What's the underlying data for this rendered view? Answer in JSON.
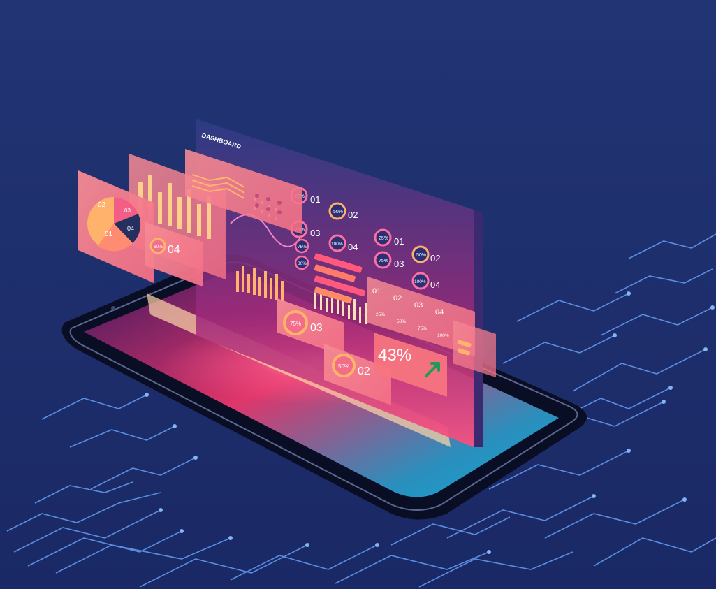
{
  "dashboard": {
    "title": "DASHBOARD"
  },
  "cards": {
    "pie": {
      "labels": [
        "02",
        "03",
        "04",
        "01"
      ]
    },
    "left_stat": {
      "percent": "60%",
      "number": "04"
    },
    "main_list": {
      "rows": [
        {
          "percent": "25%",
          "number": "01"
        },
        {
          "percent": "50%",
          "number": "02"
        },
        {
          "percent": "75%",
          "number": "03"
        },
        {
          "percent": "100%",
          "number": "04"
        }
      ]
    },
    "right_list": {
      "rows": [
        {
          "percent": "25%",
          "number": "01"
        },
        {
          "percent": "50%",
          "number": "02"
        },
        {
          "percent": "75%",
          "number": "03"
        },
        {
          "percent": "100%",
          "number": "04"
        }
      ]
    },
    "mid_left": {
      "percent": "75%",
      "number": "03"
    },
    "mid_bottom": {
      "percent": "50%",
      "number": "02"
    },
    "highlight": {
      "value": "43%"
    },
    "small_stats": [
      "75%",
      "80%"
    ],
    "bottom_right": {
      "numbers": [
        "01",
        "02",
        "03",
        "04"
      ],
      "percents": [
        "25%",
        "50%",
        "75%",
        "100%"
      ]
    }
  },
  "colors": {
    "background_top": "#20306f",
    "background_bottom": "#1a2a66",
    "panel_pink": "#f0748a",
    "panel_orange": "#f7a577",
    "circuit": "#6da7ff",
    "phone_body": "#0b0f26",
    "glow": "#ff4d86"
  }
}
